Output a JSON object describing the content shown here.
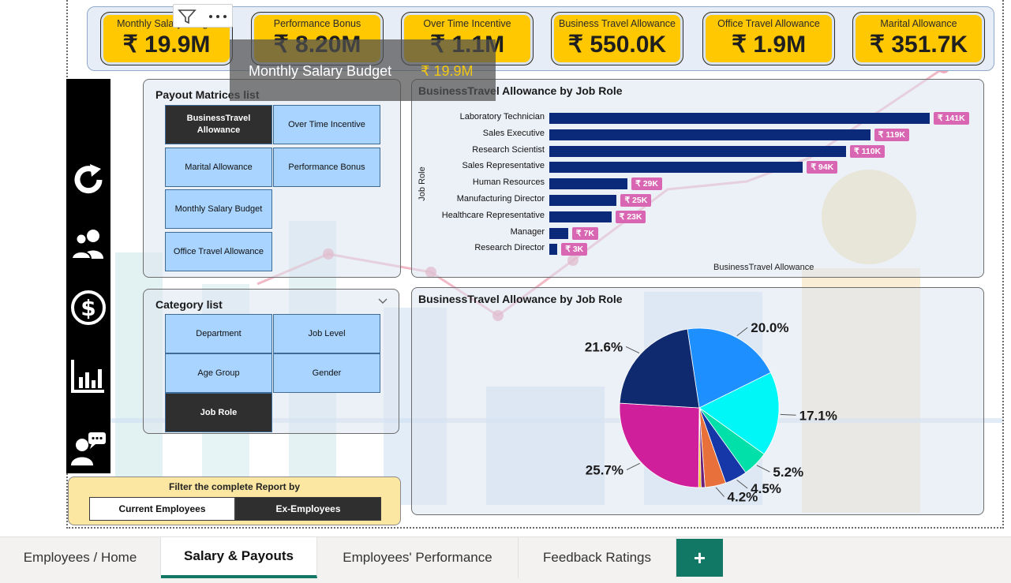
{
  "kpis": [
    {
      "label": "Monthly Salary Budget",
      "value": "₹ 19.9M"
    },
    {
      "label": "Performance Bonus",
      "value": "₹ 8.20M"
    },
    {
      "label": "Over Time Incentive",
      "value": "₹ 1.1M"
    },
    {
      "label": "Business Travel Allowance",
      "value": "₹ 550.0K"
    },
    {
      "label": "Office Travel Allowance",
      "value": "₹ 1.9M"
    },
    {
      "label": "Marital Allowance",
      "value": "₹ 351.7K"
    }
  ],
  "tooltip": {
    "label": "Monthly Salary Budget",
    "value": "₹ 19.9M"
  },
  "viz_toolbar": {
    "filter_icon": "filter-icon",
    "more_icon": "more-options-icon"
  },
  "sidebar": {
    "icons": [
      "refresh-icon",
      "users-icon",
      "dollar-icon",
      "bar-chart-icon",
      "feedback-icon"
    ]
  },
  "payout_slicer": {
    "title": "Payout Matrices list",
    "items": [
      {
        "label": "BusinessTravel Allowance",
        "selected": true
      },
      {
        "label": "Over Time Incentive",
        "selected": false
      },
      {
        "label": "Marital Allowance",
        "selected": false
      },
      {
        "label": "Performance Bonus",
        "selected": false
      },
      {
        "label": "Monthly Salary Budget",
        "selected": false
      },
      {
        "label": "Office Travel Allowance",
        "selected": false
      }
    ]
  },
  "category_slicer": {
    "title": "Category list",
    "items": [
      {
        "label": "Department",
        "selected": false
      },
      {
        "label": "Job Level",
        "selected": false
      },
      {
        "label": "Age Group",
        "selected": false
      },
      {
        "label": "Gender",
        "selected": false
      },
      {
        "label": "Job Role",
        "selected": true
      }
    ]
  },
  "filter_bar": {
    "title": "Filter the complete Report by",
    "options": [
      {
        "label": "Current Employees",
        "selected": false
      },
      {
        "label": "Ex-Employees",
        "selected": true
      }
    ]
  },
  "tabs": [
    {
      "label": "Employees / Home",
      "active": false
    },
    {
      "label": "Salary & Payouts",
      "active": true
    },
    {
      "label": "Employees' Performance",
      "active": false
    },
    {
      "label": "Feedback Ratings",
      "active": false
    }
  ],
  "add_tab_label": "+",
  "colors": {
    "kpi": "#ffc800",
    "bar": "#0b2a7a",
    "data_label": "#d966b3",
    "active_tab": "#117865"
  },
  "chart_data": [
    {
      "type": "bar",
      "orientation": "horizontal",
      "title": "BusinessTravel Allowance by Job Role",
      "xlabel": "BusinessTravel Allowance",
      "ylabel": "Job Role",
      "categories": [
        "Laboratory Technician",
        "Sales Executive",
        "Research Scientist",
        "Sales Representative",
        "Human Resources",
        "Manufacturing Director",
        "Healthcare Representative",
        "Manager",
        "Research Director"
      ],
      "values": [
        141,
        119,
        110,
        94,
        29,
        25,
        23,
        7,
        3
      ],
      "value_labels": [
        "₹ 141K",
        "₹ 119K",
        "₹ 110K",
        "₹ 94K",
        "₹ 29K",
        "₹ 25K",
        "₹ 23K",
        "₹ 7K",
        "₹ 3K"
      ],
      "unit": "K"
    },
    {
      "type": "pie",
      "title": "BusinessTravel Allowance by Job Role",
      "values": [
        20.0,
        17.1,
        5.2,
        4.5,
        4.2,
        0.8,
        0.5,
        25.7,
        21.6
      ],
      "colors": [
        "#1e8fff",
        "#00f7f7",
        "#00e0a8",
        "#1537a8",
        "#e8703a",
        "#6b1f7a",
        "#f0c419",
        "#d01f9a",
        "#0f2a6e"
      ],
      "labels": [
        "20.0%",
        "17.1%",
        "5.2%",
        "4.5%",
        "4.2%",
        "",
        "",
        "25.7%",
        "21.6%"
      ]
    }
  ]
}
